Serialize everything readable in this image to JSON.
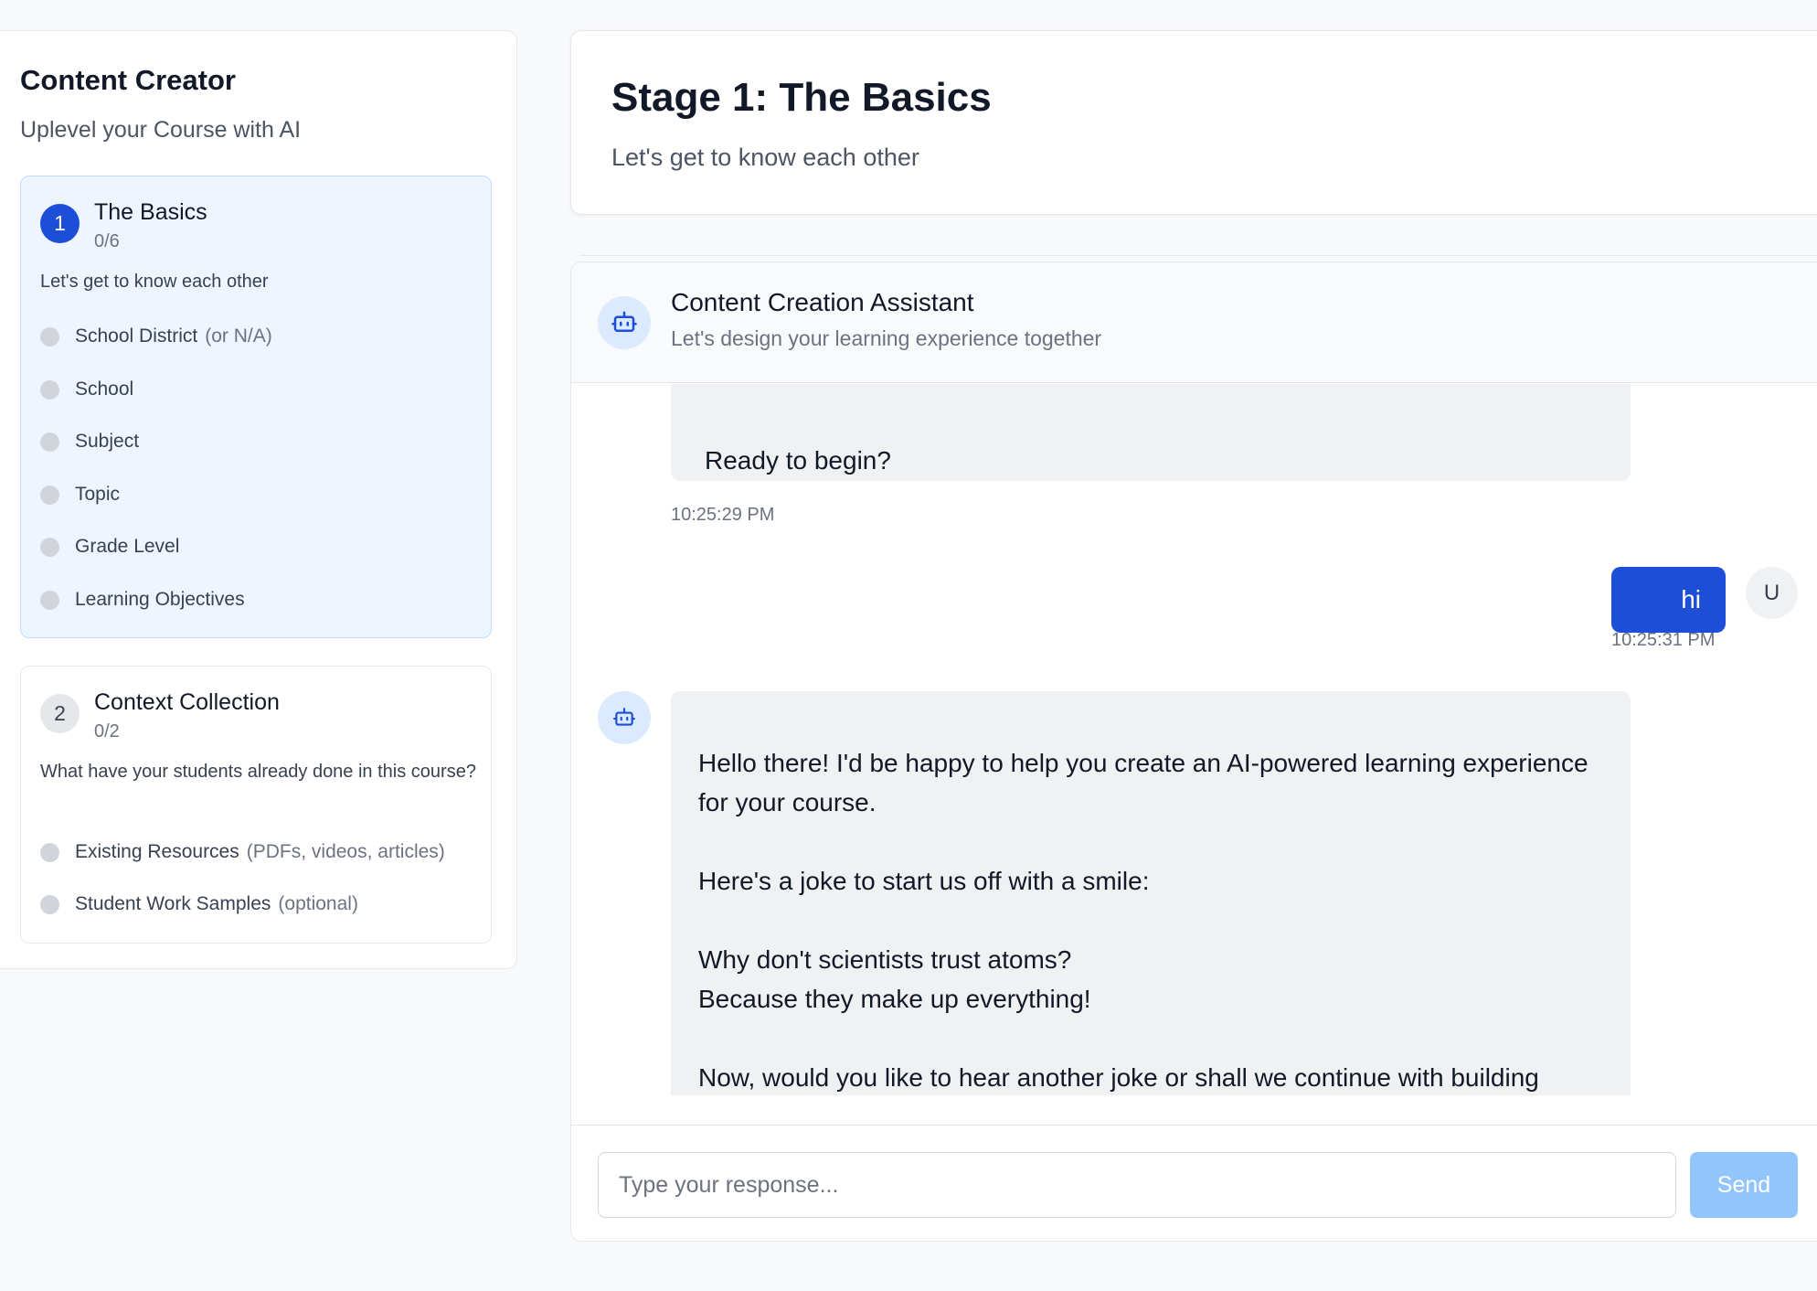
{
  "sidebar": {
    "title": "Content Creator",
    "subtitle": "Uplevel your Course with AI",
    "stages": [
      {
        "number": "1",
        "name": "The Basics",
        "progress": "0/6",
        "description": "Let's get to know each other",
        "fields": [
          {
            "label": "School District",
            "hint": "(or N/A)"
          },
          {
            "label": "School",
            "hint": ""
          },
          {
            "label": "Subject",
            "hint": ""
          },
          {
            "label": "Topic",
            "hint": ""
          },
          {
            "label": "Grade Level",
            "hint": ""
          },
          {
            "label": "Learning Objectives",
            "hint": ""
          }
        ]
      },
      {
        "number": "2",
        "name": "Context Collection",
        "progress": "0/2",
        "description": "What have your students already done in this course?",
        "fields": [
          {
            "label": "Existing Resources",
            "hint": "(PDFs, videos, articles)"
          },
          {
            "label": "Student Work Samples",
            "hint": "(optional)"
          }
        ]
      }
    ]
  },
  "stage_header": {
    "title": "Stage 1: The Basics",
    "subtitle": "Let's get to know each other"
  },
  "chat": {
    "assistant_name": "Content Creation Assistant",
    "assistant_subtitle": "Let's design your learning experience together",
    "messages": [
      {
        "sender": "bot",
        "text": "Ready to begin?",
        "time": "10:25:29 PM"
      },
      {
        "sender": "user",
        "text": "hi",
        "time": "10:25:31 PM",
        "avatar": "U"
      },
      {
        "sender": "bot",
        "text": "Hello there! I'd be happy to help you create an AI-powered learning experience for your course.\n\nHere's a joke to start us off with a smile:\n\nWhy don't scientists trust atoms?\nBecause they make up everything!\n\nNow, would you like to hear another joke or shall we continue with building your AI learning experience?",
        "time": ""
      }
    ],
    "input_placeholder": "Type your response...",
    "input_value": "",
    "send_label": "Send"
  },
  "colors": {
    "accent": "#1d4ed8",
    "active_stage_bg": "#eef5ff",
    "send_disabled": "#93c5fd",
    "bot_bubble": "#f0f1f3"
  },
  "icons": {
    "assistant": "robot-icon"
  }
}
